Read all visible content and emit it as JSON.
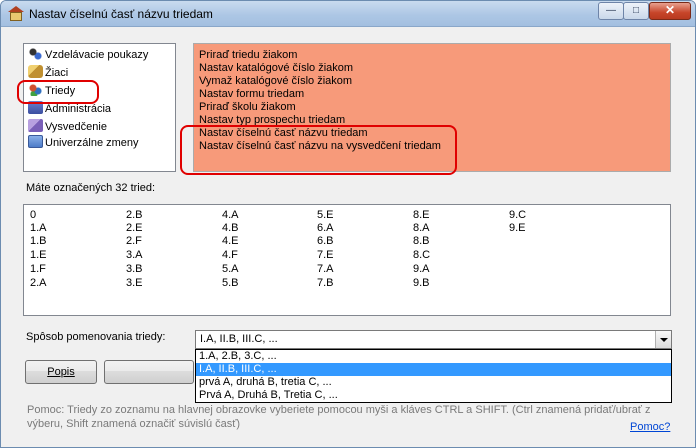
{
  "window": {
    "title": "Nastav číselnú časť názvu triedam",
    "buttons": {
      "minimize": "—",
      "maximize": "□",
      "close": "✕"
    }
  },
  "categories": [
    {
      "label": "Vzdelávacie poukazy",
      "icon": "voucher-icon"
    },
    {
      "label": "Žiaci",
      "icon": "students-icon"
    },
    {
      "label": "Triedy",
      "icon": "classes-icon"
    },
    {
      "label": "Administrácia",
      "icon": "admin-icon"
    },
    {
      "label": "Vysvedčenie",
      "icon": "certificate-icon"
    },
    {
      "label": "Univerzálne zmeny",
      "icon": "universal-changes-icon"
    }
  ],
  "actions": [
    "Priraď triedu žiakom",
    "Nastav katalógové číslo žiakom",
    "Vymaž katalógové číslo žiakom",
    "Nastav formu triedam",
    "Priraď školu žiakom",
    "Nastav typ prospechu triedam",
    "Nastav číselnú časť názvu triedam",
    "Nastav číselnú časť názvu na vysvedčení triedam"
  ],
  "count_label": "Máte označených 32 tried:",
  "classes": [
    [
      "0",
      "1.A",
      "1.B",
      "1.E",
      "1.F",
      "2.A"
    ],
    [
      "2.B",
      "2.E",
      "2.F",
      "3.A",
      "3.B",
      "3.E"
    ],
    [
      "4.A",
      "4.B",
      "4.E",
      "4.F",
      "5.A",
      "5.B"
    ],
    [
      "5.E",
      "6.A",
      "6.B",
      "7.E",
      "7.A",
      "7.B"
    ],
    [
      "8.E",
      "8.A",
      "8.B",
      "8.C",
      "9.A",
      "9.B"
    ],
    [
      "9.C",
      "9.E"
    ]
  ],
  "naming": {
    "label": "Spôsob pomenovania triedy:",
    "selected": "I.A, II.B, III.C, ...",
    "options": [
      "1.A, 2.B, 3.C, ...",
      "I.A, II.B, III.C, ...",
      "prvá A, druhá B, tretia C, ...",
      "Prvá A, Druhá B, Tretia C, ..."
    ],
    "highlighted_index": 1
  },
  "buttons": {
    "popis": "Popis",
    "second": ""
  },
  "help_text": "Pomoc: Triedy zo zoznamu na hlavnej obrazovke vyberiete pomocou myši a kláves CTRL a SHIFT. (Ctrl znamená pridať/ubrať z výberu, Shift znamená označiť súvislú časť)",
  "help_link": "Pomoc?",
  "colors": {
    "actions_bg": "#f79a7a",
    "highlight_border": "#e00000",
    "selection": "#3399ff",
    "link": "#0046d5"
  }
}
